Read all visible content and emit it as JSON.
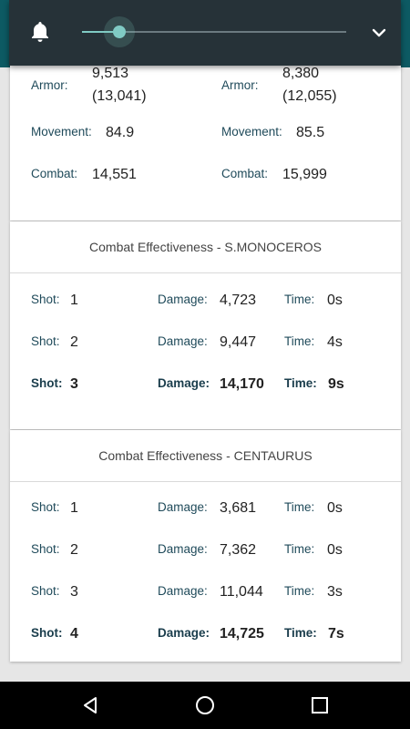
{
  "volume_panel": {
    "bell_icon": "bell-icon",
    "level": 0.14,
    "expand_icon": "chevron-down-icon"
  },
  "stats": {
    "left": {
      "armor_label": "Armor:",
      "armor_value": "9,513",
      "armor_sub": "(13,041)",
      "movement_label": "Movement:",
      "movement_value": "84.9",
      "combat_label": "Combat:",
      "combat_value": "14,551"
    },
    "right": {
      "armor_label": "Armor:",
      "armor_value": "8,380",
      "armor_sub": "(12,055)",
      "movement_label": "Movement:",
      "movement_value": "85.5",
      "combat_label": "Combat:",
      "combat_value": "15,999"
    }
  },
  "labels": {
    "shot": "Shot:",
    "damage": "Damage:",
    "time": "Time:"
  },
  "monoceros": {
    "title": "Combat Effectiveness - S.MONOCEROS",
    "rows": [
      {
        "shot": "1",
        "damage": "4,723",
        "time": "0s"
      },
      {
        "shot": "2",
        "damage": "9,447",
        "time": "4s"
      },
      {
        "shot": "3",
        "damage": "14,170",
        "time": "9s"
      }
    ]
  },
  "centaurus": {
    "title": "Combat Effectiveness - CENTAURUS",
    "rows": [
      {
        "shot": "1",
        "damage": "3,681",
        "time": "0s"
      },
      {
        "shot": "2",
        "damage": "7,362",
        "time": "0s"
      },
      {
        "shot": "3",
        "damage": "11,044",
        "time": "3s"
      },
      {
        "shot": "4",
        "damage": "14,725",
        "time": "7s"
      }
    ]
  },
  "nav": {
    "back_icon": "back-icon",
    "home_icon": "home-icon",
    "recents_icon": "recents-icon"
  }
}
